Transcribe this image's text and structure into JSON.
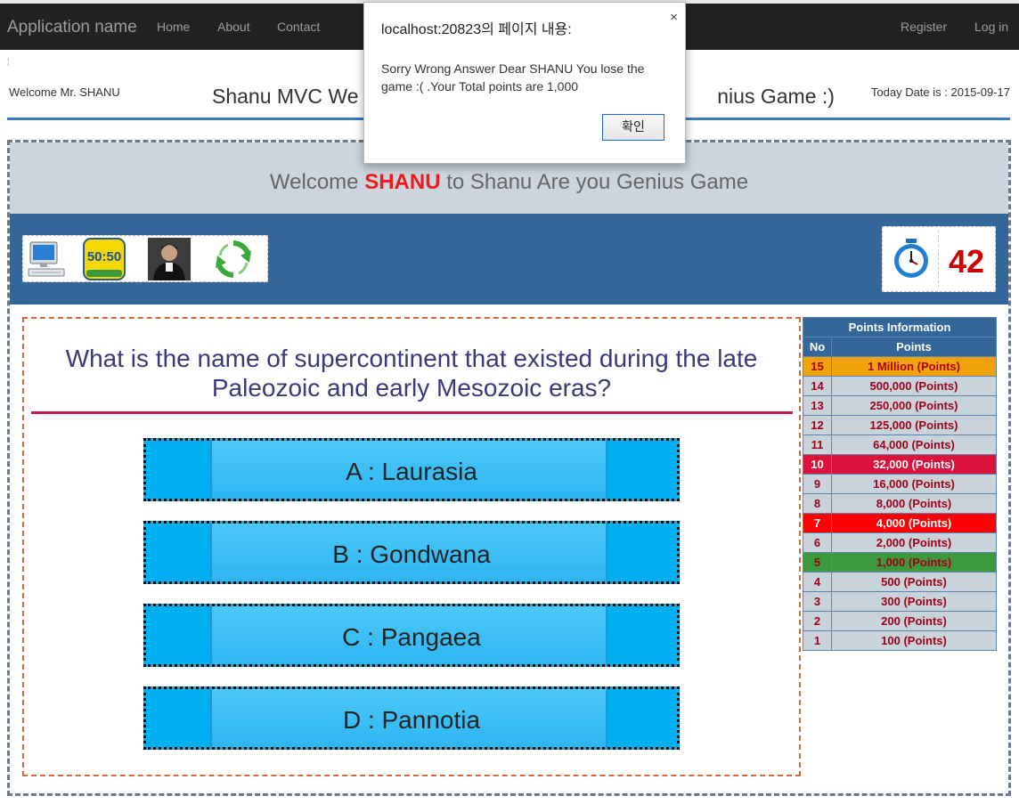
{
  "navbar": {
    "brand": "Application name",
    "links": [
      "Home",
      "About",
      "Contact"
    ],
    "right_links": [
      "Register",
      "Log in"
    ]
  },
  "header": {
    "welcome": "Welcome Mr. SHANU",
    "title_left": "Shanu MVC We",
    "title_right": "nius Game :)",
    "today": "Today Date is : 2015-09-17",
    "tiny_mark": "¦"
  },
  "banner": {
    "prefix": "Welcome ",
    "user": "SHANU",
    "suffix": " to Shanu Are you Genius Game"
  },
  "lifelines": [
    "computer-icon",
    "fifty-fifty-icon",
    "phone-friend-icon",
    "swap-question-icon"
  ],
  "lifeline_text": {
    "fifty": "50:50"
  },
  "timer": {
    "icon": "stopwatch-icon",
    "seconds": "42"
  },
  "question": {
    "text": "What is the name of supercontinent that existed during the late Paleozoic and early Mesozoic eras?",
    "answers": [
      "A : Laurasia",
      "B : Gondwana",
      "C : Pangaea",
      "D : Pannotia"
    ]
  },
  "points_table": {
    "caption": "Points Information",
    "headers": [
      "No",
      "Points"
    ],
    "rows": [
      {
        "no": "15",
        "points": "1 Million (Points)",
        "bg": "#f0a30a",
        "fg": "#b0000e"
      },
      {
        "no": "14",
        "points": "500,000 (Points)",
        "bg": "#c9d3dc",
        "fg": "#a00018"
      },
      {
        "no": "13",
        "points": "250,000 (Points)",
        "bg": "#c9d3dc",
        "fg": "#a00018"
      },
      {
        "no": "12",
        "points": "125,000 (Points)",
        "bg": "#c9d3dc",
        "fg": "#a00018"
      },
      {
        "no": "11",
        "points": "64,000 (Points)",
        "bg": "#c9d3dc",
        "fg": "#a00018"
      },
      {
        "no": "10",
        "points": "32,000 (Points)",
        "bg": "#dc143c",
        "fg": "#ffffff"
      },
      {
        "no": "9",
        "points": "16,000 (Points)",
        "bg": "#c9d3dc",
        "fg": "#a00018"
      },
      {
        "no": "8",
        "points": "8,000 (Points)",
        "bg": "#c9d3dc",
        "fg": "#a00018"
      },
      {
        "no": "7",
        "points": "4,000 (Points)",
        "bg": "#ff0000",
        "fg": "#ffffff"
      },
      {
        "no": "6",
        "points": "2,000 (Points)",
        "bg": "#c9d3dc",
        "fg": "#a00018"
      },
      {
        "no": "5",
        "points": "1,000 (Points)",
        "bg": "#3c9a3c",
        "fg": "#a00018"
      },
      {
        "no": "4",
        "points": "500 (Points)",
        "bg": "#c9d3dc",
        "fg": "#a00018"
      },
      {
        "no": "3",
        "points": "300 (Points)",
        "bg": "#c9d3dc",
        "fg": "#a00018"
      },
      {
        "no": "2",
        "points": "200 (Points)",
        "bg": "#c9d3dc",
        "fg": "#a00018"
      },
      {
        "no": "1",
        "points": "100 (Points)",
        "bg": "#c9d3dc",
        "fg": "#a00018"
      }
    ]
  },
  "alert": {
    "title": "localhost:20823의 페이지 내용:",
    "message": "Sorry Wrong Answer Dear  SHANU You lose the game :( .Your Total points are 1,000",
    "ok": "확인",
    "close": "×"
  }
}
